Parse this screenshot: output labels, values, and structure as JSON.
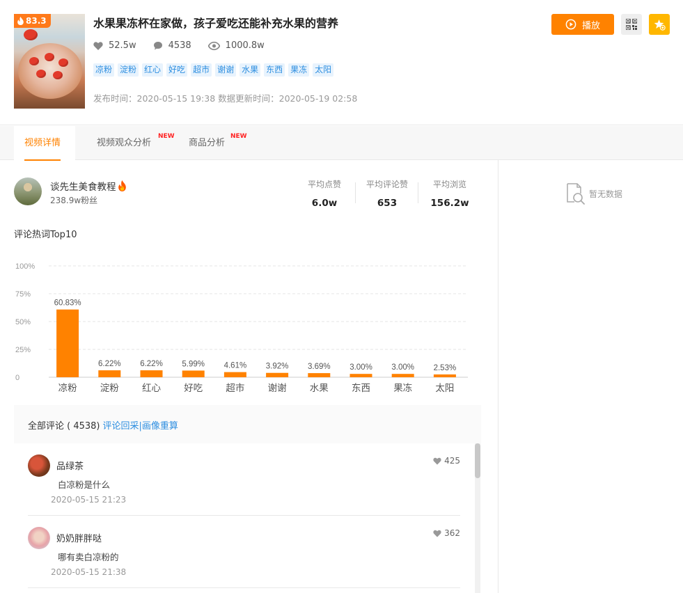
{
  "video": {
    "hot_score": "83.3",
    "title": "水果果冻杯在家做，孩子爱吃还能补充水果的营养",
    "likes": "52.5w",
    "comments": "4538",
    "views": "1000.8w",
    "tags": [
      "凉粉",
      "淀粉",
      "红心",
      "好吃",
      "超市",
      "谢谢",
      "水果",
      "东西",
      "果冻",
      "太阳"
    ],
    "publish_time": "发布时间：2020-05-15 19:38",
    "update_time": "数据更新时间：2020-05-19 02:58"
  },
  "actions": {
    "play_label": "播放"
  },
  "tabs": [
    {
      "label": "视频详情",
      "badge": ""
    },
    {
      "label": "视频观众分析",
      "badge": "NEW"
    },
    {
      "label": "商品分析",
      "badge": "NEW"
    }
  ],
  "author": {
    "name": "谈先生美食教程",
    "fans": "238.9w粉丝"
  },
  "averages": [
    {
      "label": "平均点赞",
      "value": "6.0w"
    },
    {
      "label": "平均评论赞",
      "value": "653"
    },
    {
      "label": "平均浏览",
      "value": "156.2w"
    }
  ],
  "hotwords_title": "评论热词Top10",
  "chart_data": {
    "type": "bar",
    "title": "",
    "xlabel": "",
    "ylabel": "",
    "categories": [
      "凉粉",
      "淀粉",
      "红心",
      "好吃",
      "超市",
      "谢谢",
      "水果",
      "东西",
      "果冻",
      "太阳"
    ],
    "values": [
      60.83,
      6.22,
      6.22,
      5.99,
      4.61,
      3.92,
      3.69,
      3.0,
      3.0,
      2.53
    ],
    "value_labels": [
      "60.83%",
      "6.22%",
      "6.22%",
      "5.99%",
      "4.61%",
      "3.92%",
      "3.69%",
      "3.00%",
      "3.00%",
      "2.53%"
    ],
    "yticks": [
      "0",
      "25%",
      "50%",
      "75%",
      "100%"
    ],
    "ylim": [
      0,
      100
    ],
    "grid": true,
    "color": "#ff8200"
  },
  "comments_section": {
    "header": "全部评论 ( 4538)",
    "link": "评论回采|画像重算",
    "items": [
      {
        "user": "品绿茶",
        "text": "白凉粉是什么",
        "time": "2020-05-15 21:23",
        "likes": "425"
      },
      {
        "user": "奶奶胖胖哒",
        "text": "哪有卖白凉粉的",
        "time": "2020-05-15 21:38",
        "likes": "362"
      }
    ]
  },
  "right_panel": {
    "empty_text": "暂无数据"
  },
  "colors": {
    "accent": "#ff8200",
    "link": "#2d8ee0",
    "tag_bg": "#e8f3fd",
    "fav": "#ffb700"
  }
}
